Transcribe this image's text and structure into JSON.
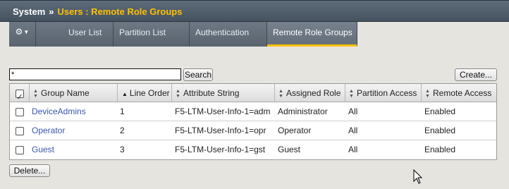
{
  "breadcrumb": {
    "root": "System",
    "separator": "»",
    "current": "Users : Remote Role Groups"
  },
  "tabs": [
    {
      "label": "Setup menu",
      "icon": "gear-icon"
    },
    {
      "label": "User List"
    },
    {
      "label": "Partition List"
    },
    {
      "label": "Authentication"
    },
    {
      "label": "Remote Role Groups",
      "active": true
    }
  ],
  "search": {
    "value": "*",
    "button": "Search"
  },
  "actions": {
    "create": "Create...",
    "delete": "Delete..."
  },
  "table": {
    "columns": [
      "Group Name",
      "Line Order",
      "Attribute String",
      "Assigned Role",
      "Partition Access",
      "Remote Access"
    ],
    "sorted_column": "Line Order",
    "rows": [
      {
        "group": "DeviceAdmins",
        "order": "1",
        "attribute": "F5-LTM-User-Info-1=adm",
        "role": "Administrator",
        "partition": "All",
        "remote": "Enabled"
      },
      {
        "group": "Operator",
        "order": "2",
        "attribute": "F5-LTM-User-Info-1=opr",
        "role": "Operator",
        "partition": "All",
        "remote": "Enabled"
      },
      {
        "group": "Guest",
        "order": "3",
        "attribute": "F5-LTM-User-Info-1=gst",
        "role": "Guest",
        "partition": "All",
        "remote": "Enabled"
      }
    ]
  },
  "colors": {
    "accent": "#ffc000",
    "link": "#3a56b0",
    "titlebar": "#4f5b68",
    "tab": "#636e79"
  }
}
